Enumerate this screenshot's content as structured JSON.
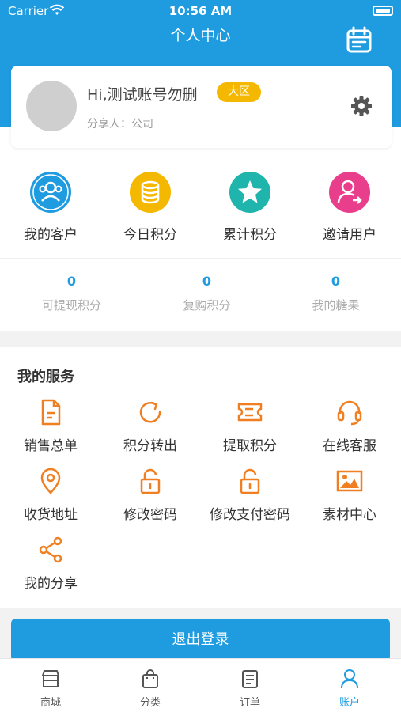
{
  "status_bar": {
    "carrier": "Carrier",
    "time": "10:56 AM"
  },
  "header": {
    "title": "个人中心"
  },
  "profile": {
    "greeting": "Hi,测试账号勿删",
    "badge": "大区",
    "sharer": "分享人：公司"
  },
  "quick_actions": [
    {
      "label": "我的客户",
      "icon": "customers-icon",
      "color": "#1f9be0"
    },
    {
      "label": "今日积分",
      "icon": "coins-icon",
      "color": "#f5b800"
    },
    {
      "label": "累计积分",
      "icon": "star-icon",
      "color": "#1fb5ad"
    },
    {
      "label": "邀请用户",
      "icon": "invite-user-icon",
      "color": "#e83e8c"
    }
  ],
  "stats": [
    {
      "value": "0",
      "label": "可提现积分"
    },
    {
      "value": "0",
      "label": "复购积分"
    },
    {
      "value": "0",
      "label": "我的糖果"
    }
  ],
  "services": {
    "title": "我的服务",
    "items": [
      {
        "label": "销售总单",
        "icon": "document-icon"
      },
      {
        "label": "积分转出",
        "icon": "refresh-icon"
      },
      {
        "label": "提取积分",
        "icon": "ticket-icon"
      },
      {
        "label": "在线客服",
        "icon": "headset-icon"
      },
      {
        "label": "收货地址",
        "icon": "location-pin-icon"
      },
      {
        "label": "修改密码",
        "icon": "lock-icon"
      },
      {
        "label": "修改支付密码",
        "icon": "lock-icon"
      },
      {
        "label": "素材中心",
        "icon": "image-icon"
      },
      {
        "label": "我的分享",
        "icon": "share-icon"
      }
    ]
  },
  "logout_label": "退出登录",
  "tabs": [
    {
      "label": "商城",
      "icon": "store-icon",
      "active": false
    },
    {
      "label": "分类",
      "icon": "shopping-bag-icon",
      "active": false
    },
    {
      "label": "订单",
      "icon": "order-list-icon",
      "active": false
    },
    {
      "label": "账户",
      "icon": "user-icon",
      "active": true
    }
  ],
  "colors": {
    "primary": "#1f9be0",
    "service_icon": "#f07f22",
    "badge": "#f5b800"
  }
}
